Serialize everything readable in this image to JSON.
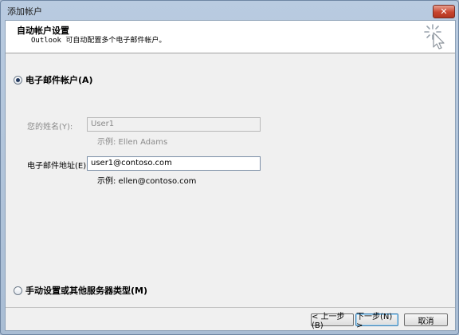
{
  "window": {
    "title": "添加帐户",
    "close_glyph": "✕"
  },
  "header": {
    "title": "自动帐户设置",
    "subtitle": "Outlook 可自动配置多个电子邮件帐户。",
    "icon": "wizard-wand-icon"
  },
  "options": {
    "email_account": {
      "label": "电子邮件帐户(A)",
      "selected": true
    },
    "manual_setup": {
      "label": "手动设置或其他服务器类型(M)",
      "selected": false
    }
  },
  "form": {
    "name": {
      "label": "您的姓名(Y):",
      "value": "User1",
      "hint": "示例: Ellen Adams",
      "enabled": false
    },
    "email": {
      "label": "电子邮件地址(E):",
      "value": "user1@contoso.com",
      "hint": "示例: ellen@contoso.com",
      "enabled": true
    }
  },
  "buttons": {
    "back": "< 上一步(B)",
    "next": "下一步(N) >",
    "cancel": "取消"
  }
}
